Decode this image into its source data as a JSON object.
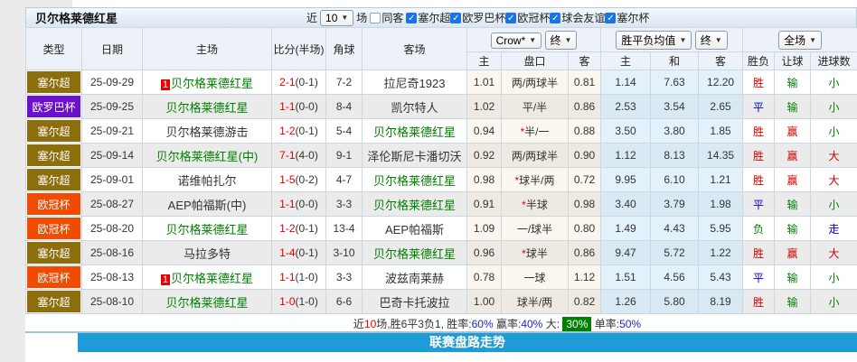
{
  "page": {
    "title": "贝尔格莱德红星"
  },
  "controls": {
    "recent_label": "近",
    "recent_value": "10",
    "matches_label": "场",
    "same_venue": {
      "label": "同客",
      "checked": false
    },
    "leagues": [
      {
        "label": "塞尔超",
        "checked": true
      },
      {
        "label": "欧罗巴杯",
        "checked": true
      },
      {
        "label": "欧冠杯",
        "checked": true
      },
      {
        "label": "球会友谊",
        "checked": true
      },
      {
        "label": "塞尔杯",
        "checked": true
      }
    ]
  },
  "table": {
    "group_selects": {
      "odds_company": "Crow*",
      "odds_state": "终",
      "mean_label": "胜平负均值",
      "mean_state": "终",
      "scope": "全场"
    },
    "col_headers": [
      "类型",
      "日期",
      "主场",
      "比分(半场)",
      "角球",
      "客场",
      "主",
      "盘口",
      "客",
      "主",
      "和",
      "客",
      "胜负",
      "让球",
      "进球数"
    ],
    "type_colors": {
      "塞尔超": "#8d6e0c",
      "欧罗巴杯": "#6b11cb",
      "欧冠杯": "#f04b00"
    },
    "rows": [
      {
        "type": "塞尔超",
        "date": "25-09-29",
        "home": {
          "text": "贝尔格莱德红星",
          "green": true,
          "badge": true
        },
        "score_ft": "2-1",
        "score_ht": "(0-1)",
        "corner": "7-2",
        "away": {
          "text": "拉尼奇1923",
          "green": false
        },
        "odds": [
          "1.01",
          "两/两球半",
          "0.81"
        ],
        "handicap_star": false,
        "means": [
          "1.14",
          "7.63",
          "12.20"
        ],
        "results": [
          {
            "t": "胜",
            "c": "red"
          },
          {
            "t": "输",
            "c": "grn"
          },
          {
            "t": "小",
            "c": "grn"
          }
        ]
      },
      {
        "type": "欧罗巴杯",
        "date": "25-09-25",
        "home": {
          "text": "贝尔格莱德红星",
          "green": true,
          "badge": false
        },
        "score_ft": "1-1",
        "score_ht": "(0-0)",
        "corner": "8-4",
        "away": {
          "text": "凯尔特人",
          "green": false
        },
        "odds": [
          "1.02",
          "平/半",
          "0.86"
        ],
        "handicap_star": false,
        "means": [
          "2.53",
          "3.54",
          "2.65"
        ],
        "results": [
          {
            "t": "平",
            "c": "blue"
          },
          {
            "t": "输",
            "c": "grn"
          },
          {
            "t": "小",
            "c": "grn"
          }
        ]
      },
      {
        "type": "塞尔超",
        "date": "25-09-21",
        "home": {
          "text": "贝尔格莱德游击",
          "green": false,
          "badge": false
        },
        "score_ft": "1-2",
        "score_ht": "(0-1)",
        "corner": "5-4",
        "away": {
          "text": "贝尔格莱德红星",
          "green": true
        },
        "odds": [
          "0.94",
          "半/一",
          "0.88"
        ],
        "handicap_star": true,
        "means": [
          "3.50",
          "3.80",
          "1.85"
        ],
        "results": [
          {
            "t": "胜",
            "c": "red"
          },
          {
            "t": "赢",
            "c": "red"
          },
          {
            "t": "小",
            "c": "grn"
          }
        ]
      },
      {
        "type": "塞尔超",
        "date": "25-09-14",
        "home": {
          "text": "贝尔格莱德红星(中)",
          "green": true,
          "badge": false
        },
        "score_ft": "7-1",
        "score_ht": "(4-0)",
        "corner": "9-1",
        "away": {
          "text": "泽伦斯尼卡潘切沃",
          "green": false
        },
        "odds": [
          "0.92",
          "两/两球半",
          "0.90"
        ],
        "handicap_star": false,
        "means": [
          "1.12",
          "8.13",
          "14.35"
        ],
        "results": [
          {
            "t": "胜",
            "c": "red"
          },
          {
            "t": "赢",
            "c": "red"
          },
          {
            "t": "大",
            "c": "red"
          }
        ]
      },
      {
        "type": "塞尔超",
        "date": "25-09-01",
        "home": {
          "text": "诺维帕扎尔",
          "green": false,
          "badge": false
        },
        "score_ft": "1-5",
        "score_ht": "(0-2)",
        "corner": "4-7",
        "away": {
          "text": "贝尔格莱德红星",
          "green": true
        },
        "odds": [
          "0.98",
          "球半/两",
          "0.72"
        ],
        "handicap_star": true,
        "means": [
          "9.95",
          "6.10",
          "1.21"
        ],
        "results": [
          {
            "t": "胜",
            "c": "red"
          },
          {
            "t": "赢",
            "c": "red"
          },
          {
            "t": "大",
            "c": "red"
          }
        ]
      },
      {
        "type": "欧冠杯",
        "date": "25-08-27",
        "home": {
          "text": "AEP帕福斯(中)",
          "green": false,
          "badge": false
        },
        "score_ft": "1-1",
        "score_ht": "(0-0)",
        "corner": "3-3",
        "away": {
          "text": "贝尔格莱德红星",
          "green": true
        },
        "odds": [
          "0.91",
          "半球",
          "0.98"
        ],
        "handicap_star": true,
        "means": [
          "3.40",
          "3.79",
          "1.98"
        ],
        "results": [
          {
            "t": "平",
            "c": "blue"
          },
          {
            "t": "输",
            "c": "grn"
          },
          {
            "t": "小",
            "c": "grn"
          }
        ]
      },
      {
        "type": "欧冠杯",
        "date": "25-08-20",
        "home": {
          "text": "贝尔格莱德红星",
          "green": true,
          "badge": false
        },
        "score_ft": "1-2",
        "score_ht": "(0-1)",
        "corner": "13-4",
        "away": {
          "text": "AEP帕福斯",
          "green": false
        },
        "odds": [
          "1.09",
          "一/球半",
          "0.80"
        ],
        "handicap_star": false,
        "means": [
          "1.49",
          "4.43",
          "5.95"
        ],
        "results": [
          {
            "t": "负",
            "c": "grn"
          },
          {
            "t": "输",
            "c": "grn"
          },
          {
            "t": "走",
            "c": "blue"
          }
        ]
      },
      {
        "type": "塞尔超",
        "date": "25-08-16",
        "home": {
          "text": "马拉多特",
          "green": false,
          "badge": false
        },
        "score_ft": "1-4",
        "score_ht": "(0-1)",
        "corner": "3-10",
        "away": {
          "text": "贝尔格莱德红星",
          "green": true
        },
        "odds": [
          "0.96",
          "球半",
          "0.86"
        ],
        "handicap_star": true,
        "means": [
          "9.47",
          "5.72",
          "1.22"
        ],
        "results": [
          {
            "t": "胜",
            "c": "red"
          },
          {
            "t": "赢",
            "c": "red"
          },
          {
            "t": "大",
            "c": "red"
          }
        ]
      },
      {
        "type": "欧冠杯",
        "date": "25-08-13",
        "home": {
          "text": "贝尔格莱德红星",
          "green": true,
          "badge": true
        },
        "score_ft": "1-1",
        "score_ht": "(1-0)",
        "corner": "3-3",
        "away": {
          "text": "波兹南莱赫",
          "green": false
        },
        "odds": [
          "0.78",
          "一球",
          "1.12"
        ],
        "handicap_star": false,
        "means": [
          "1.51",
          "4.56",
          "5.43"
        ],
        "results": [
          {
            "t": "平",
            "c": "blue"
          },
          {
            "t": "输",
            "c": "grn"
          },
          {
            "t": "小",
            "c": "grn"
          }
        ]
      },
      {
        "type": "塞尔超",
        "date": "25-08-10",
        "home": {
          "text": "贝尔格莱德红星",
          "green": true,
          "badge": false
        },
        "score_ft": "1-0",
        "score_ht": "(1-0)",
        "corner": "6-6",
        "away": {
          "text": "巴奇卡托波拉",
          "green": false
        },
        "odds": [
          "1.00",
          "球半/两",
          "0.82"
        ],
        "handicap_star": false,
        "means": [
          "1.26",
          "5.80",
          "8.19"
        ],
        "results": [
          {
            "t": "胜",
            "c": "red"
          },
          {
            "t": "输",
            "c": "grn"
          },
          {
            "t": "小",
            "c": "grn"
          }
        ]
      }
    ]
  },
  "summary": {
    "segments": [
      {
        "t": "近",
        "c": "k"
      },
      {
        "t": "10",
        "c": "r"
      },
      {
        "t": "场,胜6平3负1, 胜率:",
        "c": "k"
      },
      {
        "t": "60%",
        "c": "b"
      },
      {
        "t": " 赢率:",
        "c": "k"
      },
      {
        "t": "40%",
        "c": "b"
      },
      {
        "t": " 大: ",
        "c": "k"
      },
      {
        "t": "30%",
        "c": "gb"
      },
      {
        "t": " 单率:",
        "c": "k"
      },
      {
        "t": "50%",
        "c": "b"
      }
    ]
  },
  "footer_bar": {
    "label": "联赛盘路走势"
  }
}
